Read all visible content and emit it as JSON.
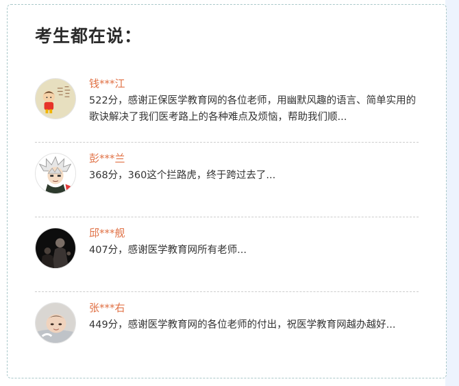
{
  "section": {
    "title": "考生都在说："
  },
  "testimonials": [
    {
      "name": "钱***江",
      "comment": "522分，感谢正保医学教育网的各位老师，用幽默风趣的语言、简单实用的歌诀解决了我们医考路上的各种难点及烦恼，帮助我们顺..."
    },
    {
      "name": "彭***兰",
      "comment": "368分，360这个拦路虎，终于跨过去了..."
    },
    {
      "name": "邱***舰",
      "comment": "407分，感谢医学教育网所有老师..."
    },
    {
      "name": "张***右",
      "comment": "449分，感谢医学教育网的各位老师的付出，祝医学教育网越办越好..."
    }
  ]
}
